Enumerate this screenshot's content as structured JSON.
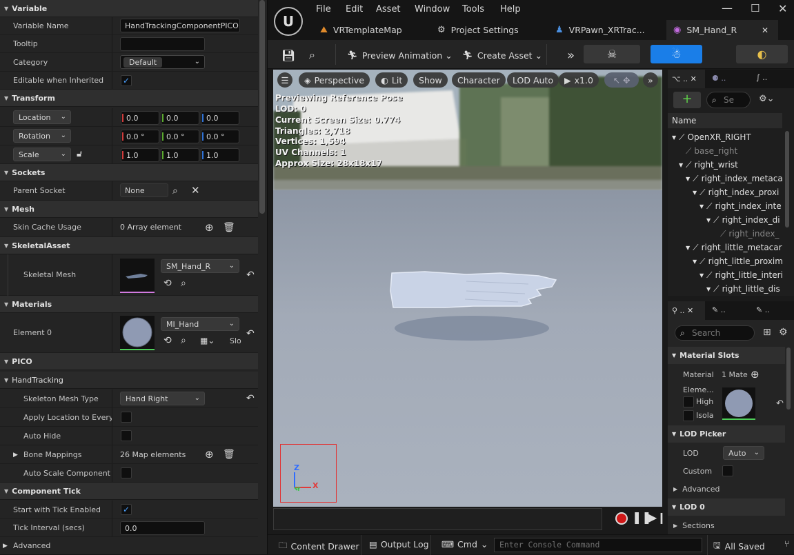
{
  "details": {
    "variable_section": "Variable",
    "variable_name_label": "Variable Name",
    "variable_name_value": "HandTrackingComponentPICO",
    "tooltip_label": "Tooltip",
    "category_label": "Category",
    "category_value": "Default",
    "editable_label": "Editable when Inherited",
    "transform_section": "Transform",
    "location_label": "Location",
    "rotation_label": "Rotation",
    "scale_label": "Scale",
    "location": [
      "0.0",
      "0.0",
      "0.0"
    ],
    "rotation": [
      "0.0 °",
      "0.0 °",
      "0.0 °"
    ],
    "scale": [
      "1.0",
      "1.0",
      "1.0"
    ],
    "sockets_section": "Sockets",
    "parent_socket_label": "Parent Socket",
    "parent_socket_value": "None",
    "mesh_section": "Mesh",
    "skin_cache_label": "Skin Cache Usage",
    "skin_cache_value": "0 Array element",
    "skeletal_asset_section": "SkeletalAsset",
    "skeletal_mesh_label": "Skeletal Mesh",
    "skeletal_mesh_value": "SM_Hand_R",
    "materials_section": "Materials",
    "element0_label": "Element 0",
    "element0_value": "MI_Hand",
    "element0_slot": "Slo",
    "pico_section": "PICO",
    "handtracking_section": "HandTracking",
    "skeleton_mesh_type_label": "Skeleton Mesh Type",
    "skeleton_mesh_type_value": "Hand Right",
    "apply_location_label": "Apply Location to Every...",
    "auto_hide_label": "Auto Hide",
    "bone_mappings_label": "Bone Mappings",
    "bone_mappings_value": "26 Map elements",
    "auto_scale_label": "Auto Scale Component",
    "component_tick_section": "Component Tick",
    "start_tick_label": "Start with Tick Enabled",
    "tick_interval_label": "Tick Interval (secs)",
    "tick_interval_value": "0.0",
    "advanced_label": "Advanced"
  },
  "menu": [
    "File",
    "Edit",
    "Asset",
    "Window",
    "Tools",
    "Help"
  ],
  "tabs": [
    "VRTemplateMap",
    "Project Settings",
    "VRPawn_XRTrac...",
    "SM_Hand_R"
  ],
  "toolbar": {
    "preview_animation": "Preview Animation",
    "create_asset": "Create Asset"
  },
  "viewport": {
    "perspective": "Perspective",
    "lit": "Lit",
    "show": "Show",
    "character": "Character",
    "lod": "LOD Auto",
    "speed": "x1.0",
    "stats": [
      "Previewing Reference Pose",
      "LOD: 0",
      "Current Screen Size: 0.774",
      "Triangles: 2,718",
      "Vertices: 1,594",
      "UV Channels: 1",
      "Approx Size: 28x18x17"
    ],
    "axis_z": "Z",
    "axis_x": "X",
    "axis_y": "Y"
  },
  "tree": {
    "search_placeholder": "Se",
    "header": "Name",
    "items": [
      "OpenXR_RIGHT",
      "base_right",
      "right_wrist",
      "right_index_metaca",
      "right_index_proxi",
      "right_index_inte",
      "right_index_di",
      "right_index_",
      "right_little_metacar",
      "right_little_proxim",
      "right_little_interi",
      "right_little_dis"
    ]
  },
  "asset_details": {
    "search_placeholder": "Search",
    "material_slots": "Material Slots",
    "material_label": "Material",
    "material_value": "1 Mate",
    "element_label": "Eleme...",
    "high_label": "High",
    "isola_label": "Isola",
    "lod_picker": "LOD Picker",
    "lod_label": "LOD",
    "lod_value": "Auto",
    "custom_label": "Custom",
    "advanced_label": "Advanced",
    "lod0_section": "LOD 0",
    "sections_label": "Sections"
  },
  "status": {
    "content_drawer": "Content Drawer",
    "output_log": "Output Log",
    "cmd": "Cmd",
    "console_placeholder": "Enter Console Command",
    "saved": "All Saved"
  }
}
